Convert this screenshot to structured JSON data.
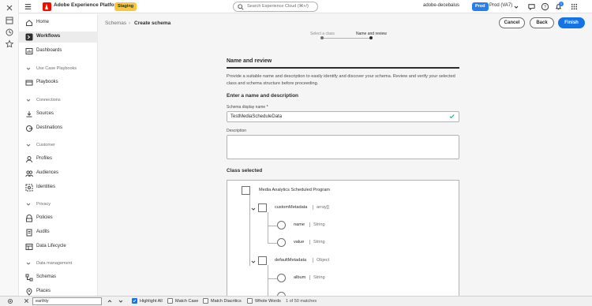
{
  "topbar": {
    "app_title": "Adobe Experience Platform",
    "staging_badge": "Staging",
    "search_placeholder": "Search Experience Cloud (⌘+/)",
    "org_name": "adobe-decebalus",
    "prod_badge": "Prod",
    "sandbox": "Prod (VA7)",
    "notification_count": "1"
  },
  "sidenav": {
    "items": [
      {
        "label": "Home",
        "icon": "home-icon"
      },
      {
        "label": "Workflows",
        "icon": "workflows-icon"
      },
      {
        "label": "Dashboards",
        "icon": "dashboard-icon"
      },
      {
        "label": "Use Case Playbooks",
        "section": true
      },
      {
        "label": "Playbooks",
        "icon": "playbooks-icon"
      },
      {
        "label": "Connections",
        "section": true
      },
      {
        "label": "Sources",
        "icon": "sources-icon"
      },
      {
        "label": "Destinations",
        "icon": "destinations-icon"
      },
      {
        "label": "Customer",
        "section": true
      },
      {
        "label": "Profiles",
        "icon": "profiles-icon"
      },
      {
        "label": "Audiences",
        "icon": "audiences-icon"
      },
      {
        "label": "Identities",
        "icon": "identities-icon"
      },
      {
        "label": "Privacy",
        "section": true
      },
      {
        "label": "Policies",
        "icon": "policies-icon"
      },
      {
        "label": "Audits",
        "icon": "audits-icon"
      },
      {
        "label": "Data Lifecycle",
        "icon": "data-lifecycle-icon"
      },
      {
        "label": "Data management",
        "section": true
      },
      {
        "label": "Schemas",
        "icon": "schemas-icon"
      },
      {
        "label": "Places",
        "icon": "places-icon"
      }
    ]
  },
  "header": {
    "breadcrumb_parent": "Schemas",
    "breadcrumb_current": "Create schema",
    "cancel_label": "Cancel",
    "back_label": "Back",
    "finish_label": "Finish",
    "steps": [
      "Select a class",
      "Name and review"
    ]
  },
  "form": {
    "title": "Name and review",
    "description": "Provide a suitable name and description to easily identify and discover your schema. Review and verify your selected class and schema structure before proceeding.",
    "subtitle": "Enter a name and description",
    "name_label": "Schema display name",
    "required_mark": "*",
    "name_value": "TestMediaScheduleData",
    "description_label": "Description",
    "description_value": "",
    "class_selected_label": "Class selected"
  },
  "tree": {
    "root": "Media Analytics Scheduled Program",
    "nodes": [
      {
        "name": "customMetadata",
        "type": "array[]"
      },
      {
        "name": "name",
        "type": "String"
      },
      {
        "name": "value",
        "type": "String"
      },
      {
        "name": "defaultMetadata",
        "type": "Object"
      },
      {
        "name": "album",
        "type": "String"
      }
    ]
  },
  "findbar": {
    "query": "earthly",
    "options": [
      {
        "label": "Highlight All",
        "checked": true
      },
      {
        "label": "Match Case",
        "checked": false
      },
      {
        "label": "Match Diacritics",
        "checked": false
      },
      {
        "label": "Whole Words",
        "checked": false
      }
    ],
    "result": "1 of 50 matches"
  }
}
